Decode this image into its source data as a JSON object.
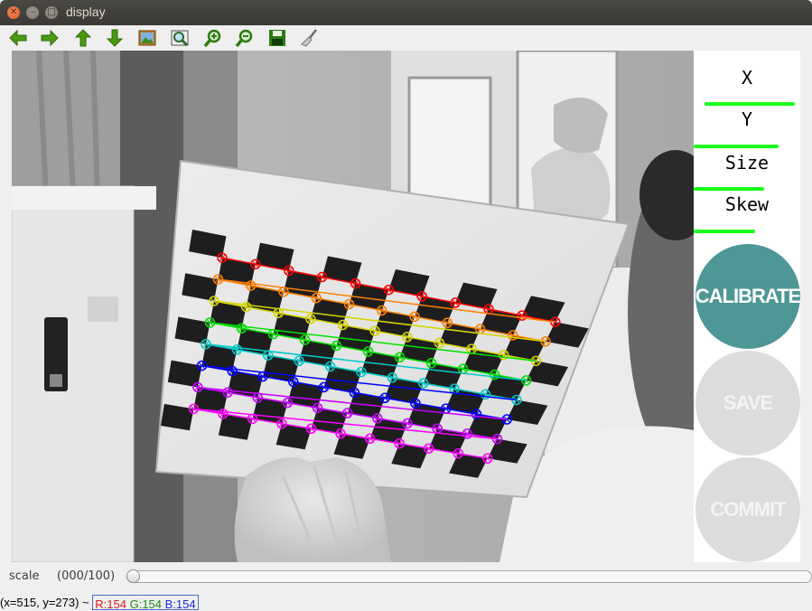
{
  "window": {
    "title": "display"
  },
  "toolbar": [
    {
      "name": "pan-left-button",
      "icon": "arrow-left-icon"
    },
    {
      "name": "pan-right-button",
      "icon": "arrow-right-icon"
    },
    {
      "name": "pan-up-button",
      "icon": "arrow-up-icon"
    },
    {
      "name": "pan-down-button",
      "icon": "arrow-down-icon"
    },
    {
      "name": "zoom-fit-button",
      "icon": "image-icon"
    },
    {
      "name": "zoom-original-button",
      "icon": "zoom-region-icon"
    },
    {
      "name": "zoom-in-button",
      "icon": "zoom-in-icon"
    },
    {
      "name": "zoom-out-button",
      "icon": "zoom-out-icon"
    },
    {
      "name": "save-image-button",
      "icon": "floppy-disk-icon"
    },
    {
      "name": "properties-button",
      "icon": "brush-icon"
    }
  ],
  "panel": {
    "x_label": "X",
    "y_label": "Y",
    "size_label": "Size",
    "skew_label": "Skew",
    "x_progress": 0.85,
    "y_progress": 0.82,
    "size_progress": 0.8,
    "skew_progress": 0.6,
    "calibrate_label": "CALIBRATE",
    "save_label": "SAVE",
    "commit_label": "COMMIT",
    "bar_color": "#19ff19",
    "calibrate_color": "#4e9797",
    "disabled_color": "#dcdcdc"
  },
  "scale": {
    "label": "scale",
    "value_text": "(000/100)",
    "value": 0
  },
  "status": {
    "coords": "(x=515, y=273) ~ ",
    "r": "R:154",
    "g": "G:154",
    "b": "B:154"
  }
}
